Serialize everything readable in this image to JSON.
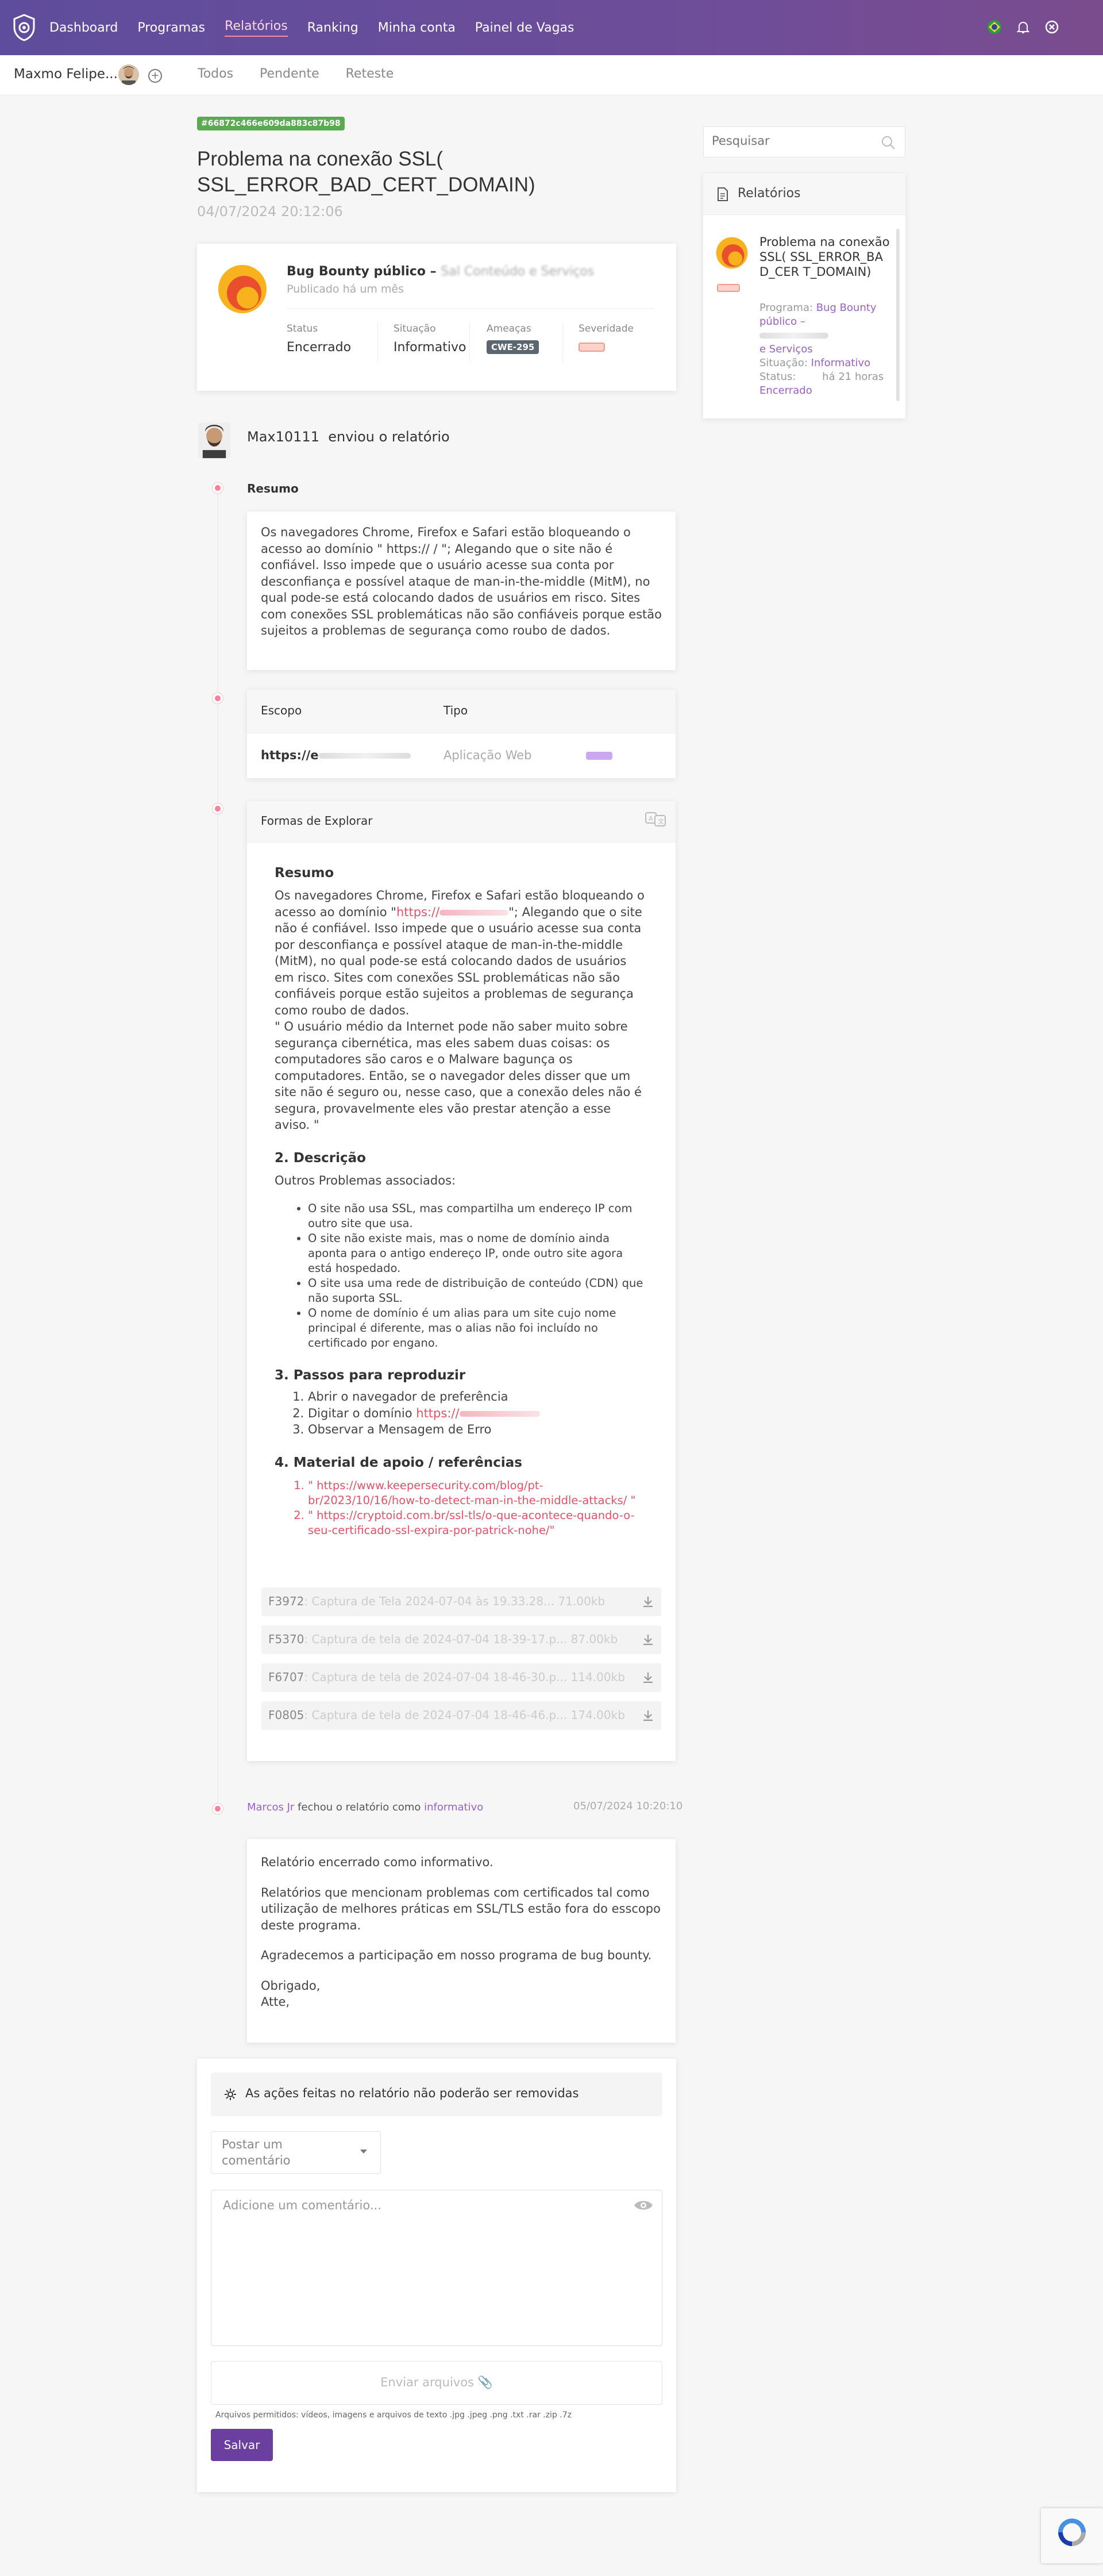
{
  "nav": {
    "items": [
      "Dashboard",
      "Programas",
      "Relatórios",
      "Ranking",
      "Minha conta",
      "Painel de Vagas"
    ],
    "active": "Relatórios"
  },
  "subbar": {
    "user_name": "Maxmo Felipe...",
    "tabs": [
      "Todos",
      "Pendente",
      "Reteste"
    ]
  },
  "report": {
    "hash": "#66872c466e609da883c87b98",
    "title": "Problema na conexão SSL( SSL_ERROR_BAD_CERT_DOMAIN)",
    "date": "04/07/2024 20:12:06"
  },
  "program": {
    "name": "Bug Bounty público –",
    "name_rest": "Sal Conteúdo e Serviços",
    "published": "Publicado há um mês",
    "labels": {
      "status": "Status",
      "situation": "Situação",
      "threats": "Ameaças",
      "severity": "Severidade"
    },
    "status": "Encerrado",
    "situation": "Informativo",
    "threat": "CWE-295"
  },
  "sidebar": {
    "search_placeholder": "Pesquisar",
    "header": "Relatórios",
    "item": {
      "title": "Problema na conexão SSL( SSL_ERROR_BAD_CER T_DOMAIN)",
      "program_label": "Programa:",
      "program_value": "Bug Bounty público –",
      "program_value2": "e Serviços",
      "situation_label": "Situação:",
      "situation_value": "Informativo",
      "status_label": "Status:",
      "status_value": "Encerrado",
      "time": "há 21 horas"
    }
  },
  "timeline": {
    "author": "Max10111",
    "action": "enviou o relatório",
    "summary_title": "Resumo",
    "summary_text": "Os navegadores Chrome, Firefox e Safari estão bloqueando o acesso ao domínio \" https://                 / \"; Alegando que o site não é confiável. Isso impede que o usuário acesse sua conta por desconfiança e possível ataque de man-in-the-middle (MitM), no qual pode-se está colocando dados de usuários em risco. Sites com conexões SSL problemáticas não são confiáveis porque estão sujeitos a problemas de segurança como roubo de dados.",
    "scope_label": "Escopo",
    "type_label": "Tipo",
    "scope_value": "https://e",
    "type_value": "Aplicação Web",
    "explore_title": "Formas de Explorar",
    "explore": {
      "h_resumo": "Resumo",
      "p1_a": "Os navegadores Chrome, Firefox e Safari estão bloqueando o acesso ao domínio \"",
      "p1_link": "https://",
      "p1_b": "\"; Alegando que o site não é confiável. Isso impede que o usuário acesse sua conta por desconfiança e possível ataque de man-in-the-middle (MitM), no qual pode-se está colocando dados de usuários em risco. Sites com conexões SSL problemáticas não são confiáveis porque estão sujeitos a problemas de segurança como roubo de dados.",
      "p2": "\" O usuário médio da Internet pode não saber muito sobre segurança cibernética, mas eles sabem duas coisas: os computadores são caros e o Malware bagunça os computadores. Então, se o navegador deles disser que um site não é seguro ou, nesse caso, que a conexão deles não é segura, provavelmente eles vão prestar atenção a esse aviso. \"",
      "h_desc": "2. Descrição",
      "desc_intro": "Outros Problemas associados:",
      "desc_items": [
        "O site não usa SSL, mas compartilha um endereço IP com outro site que usa.",
        "O site não existe mais, mas o nome de domínio ainda aponta para o antigo endereço IP, onde outro site agora está hospedado.",
        "O site usa uma rede de distribuição de conteúdo (CDN) que não suporta SSL.",
        "O nome de domínio é um alias para um site cujo nome principal é diferente, mas o alias não foi incluído no certificado por engano."
      ],
      "h_steps": "3. Passos para reproduzir",
      "steps": [
        "Abrir o navegador de preferência",
        "Digitar o domínio",
        "Observar a Mensagem de Erro"
      ],
      "step2_link": "https://",
      "h_refs": "4. Material de apoio / referências",
      "refs": [
        "\" https://www.keepersecurity.com/blog/pt-br/2023/10/16/how-to-detect-man-in-the-middle-attacks/ \"",
        "\" https://cryptoid.com.br/ssl-tls/o-que-acontece-quando-o-seu-certificado-ssl-expira-por-patrick-nohe/\""
      ]
    },
    "attachments": [
      {
        "id": "F3972",
        "name": ": Captura de Tela 2024-07-04 às 19.33.28... 71.00kb"
      },
      {
        "id": "F5370",
        "name": ": Captura de tela de 2024-07-04 18-39-17.p... 87.00kb"
      },
      {
        "id": "F6707",
        "name": ": Captura de tela de 2024-07-04 18-46-30.p... 114.00kb"
      },
      {
        "id": "F0805",
        "name": ": Captura de tela de 2024-07-04 18-46-46.p... 174.00kb"
      }
    ],
    "close_user": "Marcos Jr",
    "close_action": "fechou o relatório como",
    "close_status": "informativo",
    "close_date": "05/07/2024 10:20:10",
    "close_msg": [
      "Relatório encerrado como informativo.",
      "Relatórios que mencionam problemas com certificados tal como utilização de melhores práticas em SSL/TLS estão fora do esscopo deste programa.",
      "Agradecemos a participação em nosso programa de bug bounty.",
      "Obrigado,",
      "Atte,"
    ]
  },
  "comment": {
    "notice": "As ações feitas no relatório não poderão ser removidas",
    "select_value": "Postar um comentário",
    "placeholder": "Adicione um comentário...",
    "upload": "Enviar arquivos",
    "allowed": "Arquivos permitidos: vídeos, imagens e arquivos de texto .jpg .jpeg .png .txt .rar .zip .7z",
    "save": "Salvar"
  }
}
